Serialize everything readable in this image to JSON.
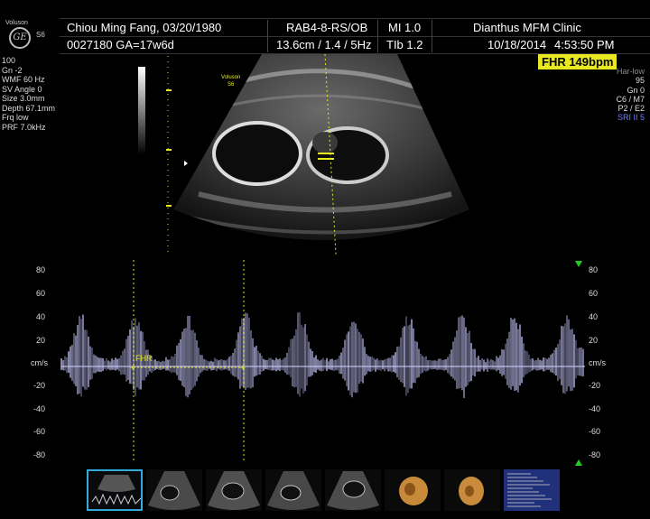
{
  "header": {
    "brand": "Voluson",
    "logo_text": "GE",
    "model": "S6",
    "patient_name_dob": "Chiou Ming Fang,  03/20/1980",
    "patient_id_ga": "0027180  GA=17w6d",
    "probe": "RAB4-8-RS/OB",
    "depth_info": "13.6cm / 1.4 /  5Hz",
    "mi": "MI  1.0",
    "tib": "TIb  1.2",
    "clinic": "Dianthus MFM Clinic",
    "date": "10/18/2014",
    "time": "4:53:50 PM"
  },
  "fhr_badge": "FHR 149bpm",
  "left_params": [
    "100",
    "Gn  -2",
    "WMF 60 Hz",
    "SV Angle  0",
    "Size  3.0mm",
    "Depth 67.1mm",
    "Frq low",
    "PRF  7.0kHz"
  ],
  "right_params": [
    "Har-low",
    "95",
    "Gn  0",
    "C6 / M7",
    "P2 / E2",
    "SRI II 5"
  ],
  "probe_label": [
    "Voluson",
    "S6"
  ],
  "doppler": {
    "unit": "cm/s",
    "ticks_left": [
      "80",
      "60",
      "40",
      "20",
      "",
      "-20",
      "-40",
      "-60",
      "-80"
    ],
    "ticks_right": [
      "80",
      "60",
      "40",
      "20",
      "",
      "-20",
      "-40",
      "-60",
      "-80"
    ],
    "measure_label": "FHR"
  },
  "thumbnails": [
    "doppler",
    "fetal-2d",
    "fetal-2d",
    "fetal-2d",
    "fetal-2d",
    "fetal-3d",
    "fetal-3d",
    "report"
  ],
  "colors": {
    "fhr_bg": "#e8e820",
    "selected_thumb": "#33aadd",
    "marker_green": "#22cc22"
  }
}
